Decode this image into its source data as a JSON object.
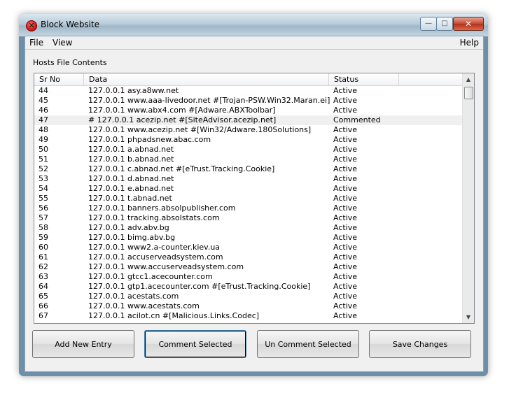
{
  "window": {
    "title": "Block Website",
    "controls": {
      "minimize": "—",
      "maximize": "□",
      "close": "✕"
    }
  },
  "menu": {
    "file": "File",
    "view": "View",
    "help": "Help"
  },
  "section_label": "Hosts File Contents",
  "table": {
    "columns": [
      "Sr No",
      "Data",
      "Status",
      ""
    ],
    "rows": [
      {
        "sr": "44",
        "data": "127.0.0.1  asy.a8ww.net",
        "status": "Active"
      },
      {
        "sr": "45",
        "data": "127.0.0.1  www.aaa-livedoor.net #[Trojan-PSW.Win32.Maran.ei]",
        "status": "Active"
      },
      {
        "sr": "46",
        "data": "127.0.0.1  www.abx4.com #[Adware.ABXToolbar]",
        "status": "Active"
      },
      {
        "sr": "47",
        "data": "# 127.0.0.1  acezip.net #[SiteAdvisor.acezip.net]",
        "status": "Commented"
      },
      {
        "sr": "48",
        "data": "127.0.0.1  www.acezip.net #[Win32/Adware.180Solutions]",
        "status": "Active"
      },
      {
        "sr": "49",
        "data": "127.0.0.1  phpadsnew.abac.com",
        "status": "Active"
      },
      {
        "sr": "50",
        "data": "127.0.0.1  a.abnad.net",
        "status": "Active"
      },
      {
        "sr": "51",
        "data": "127.0.0.1  b.abnad.net",
        "status": "Active"
      },
      {
        "sr": "52",
        "data": "127.0.0.1  c.abnad.net #[eTrust.Tracking.Cookie]",
        "status": "Active"
      },
      {
        "sr": "53",
        "data": "127.0.0.1  d.abnad.net",
        "status": "Active"
      },
      {
        "sr": "54",
        "data": "127.0.0.1  e.abnad.net",
        "status": "Active"
      },
      {
        "sr": "55",
        "data": "127.0.0.1  t.abnad.net",
        "status": "Active"
      },
      {
        "sr": "56",
        "data": "127.0.0.1  banners.absolpublisher.com",
        "status": "Active"
      },
      {
        "sr": "57",
        "data": "127.0.0.1  tracking.absolstats.com",
        "status": "Active"
      },
      {
        "sr": "58",
        "data": "127.0.0.1  adv.abv.bg",
        "status": "Active"
      },
      {
        "sr": "59",
        "data": "127.0.0.1  bimg.abv.bg",
        "status": "Active"
      },
      {
        "sr": "60",
        "data": "127.0.0.1  www2.a-counter.kiev.ua",
        "status": "Active"
      },
      {
        "sr": "61",
        "data": "127.0.0.1  accuserveadsystem.com",
        "status": "Active"
      },
      {
        "sr": "62",
        "data": "127.0.0.1  www.accuserveadsystem.com",
        "status": "Active"
      },
      {
        "sr": "63",
        "data": "127.0.0.1  gtcc1.acecounter.com",
        "status": "Active"
      },
      {
        "sr": "64",
        "data": "127.0.0.1  gtp1.acecounter.com #[eTrust.Tracking.Cookie]",
        "status": "Active"
      },
      {
        "sr": "65",
        "data": "127.0.0.1  acestats.com",
        "status": "Active"
      },
      {
        "sr": "66",
        "data": "127.0.0.1  www.acestats.com",
        "status": "Active"
      },
      {
        "sr": "67",
        "data": "127.0.0.1  acilot.cn #[Malicious.Links.Codec]",
        "status": "Active"
      }
    ],
    "commented_row_index": 3
  },
  "buttons": {
    "add": "Add New Entry",
    "comment": "Comment Selected",
    "uncomment": "Un Comment Selected",
    "save": "Save Changes"
  },
  "icons": {
    "app": "block-icon",
    "scroll_up": "▲",
    "scroll_down": "▼"
  }
}
